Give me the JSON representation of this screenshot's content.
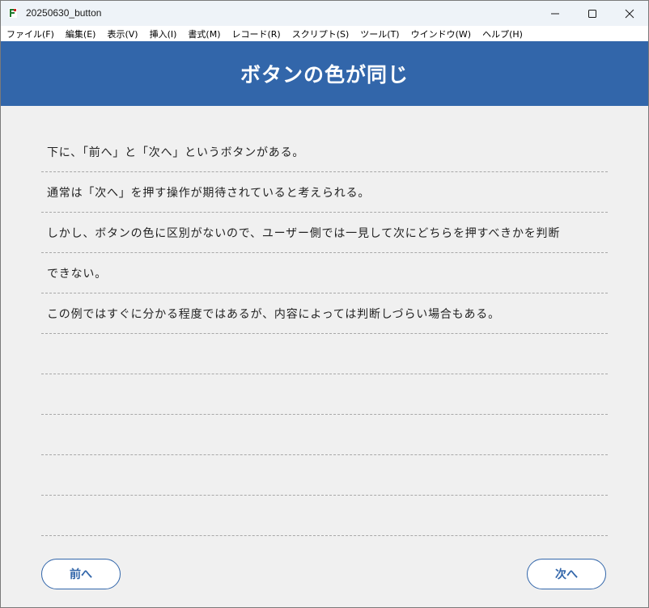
{
  "window": {
    "title": "20250630_button"
  },
  "menu": {
    "items": [
      "ファイル(F)",
      "編集(E)",
      "表示(V)",
      "挿入(I)",
      "書式(M)",
      "レコード(R)",
      "スクリプト(S)",
      "ツール(T)",
      "ウインドウ(W)",
      "ヘルプ(H)"
    ]
  },
  "header": {
    "title": "ボタンの色が同じ"
  },
  "content": {
    "lines": [
      "下に、「前へ」と「次へ」というボタンがある。",
      "通常は「次へ」を押す操作が期待されていると考えられる。",
      "しかし、ボタンの色に区別がないので、ユーザー側では一見して次にどちらを押すべきかを判断",
      "できない。",
      "この例ではすぐに分かる程度ではあるが、内容によっては判断しづらい場合もある。",
      "",
      "",
      "",
      "",
      ""
    ]
  },
  "buttons": {
    "prev_label": "前へ",
    "next_label": "次へ"
  },
  "colors": {
    "header_bg": "#3266aa",
    "button_text": "#3266aa",
    "background": "#f0f0f0"
  }
}
